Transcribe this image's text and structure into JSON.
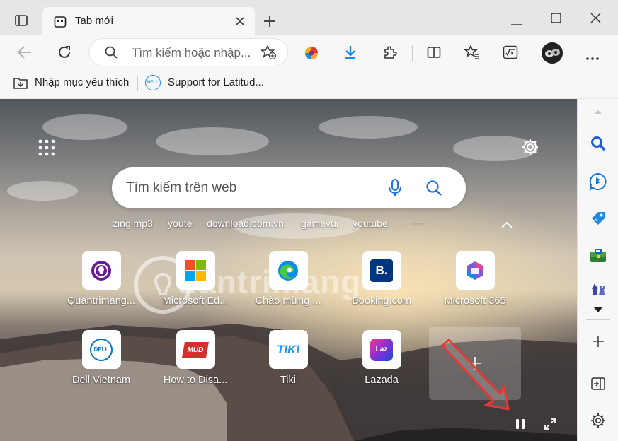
{
  "tab": {
    "title": "Tab mới"
  },
  "address_bar": {
    "placeholder": "Tìm kiếm hoặc nhập..."
  },
  "favorites": [
    {
      "label": "Nhập mục yêu thích"
    },
    {
      "label": "Support for Latitud..."
    }
  ],
  "search": {
    "placeholder": "Tìm kiếm trên web"
  },
  "quick_links": [
    "zing mp3",
    "youte",
    "download.com.vn",
    "gamevui",
    "youtube"
  ],
  "more_quick_links": "...",
  "tiles_row1": [
    {
      "label": "Quantrimang..."
    },
    {
      "label": "Microsoft Ed..."
    },
    {
      "label": "Chào mừng ..."
    },
    {
      "label": "Booking.com"
    },
    {
      "label": "Microsoft 365"
    }
  ],
  "tiles_row2": [
    {
      "label": "Dell Vietnam"
    },
    {
      "label": "How to Disa..."
    },
    {
      "label": "Tiki"
    },
    {
      "label": "Lazada"
    }
  ],
  "booking_letter": "B.",
  "tiki_letters": "TIKI",
  "lazada_letters": "Laz",
  "dell_letters": "DELL",
  "watermark": "uantrimang",
  "colors": {
    "accent": "#0078d4",
    "arrow": "#e53935"
  }
}
